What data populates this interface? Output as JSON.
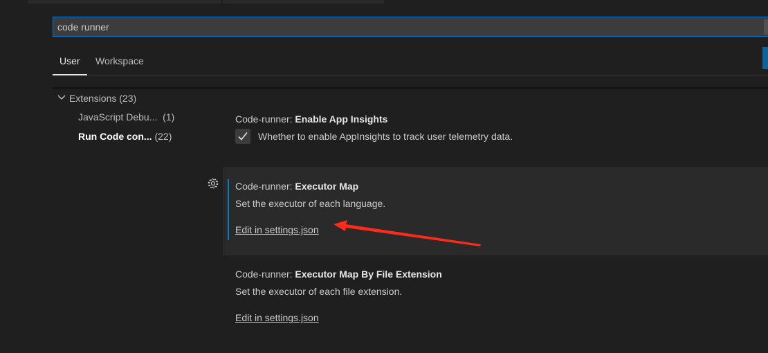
{
  "search": {
    "value": "code runner"
  },
  "tabs": [
    {
      "label": "User",
      "active": true
    },
    {
      "label": "Workspace",
      "active": false
    }
  ],
  "tree": {
    "group": {
      "label": "Extensions",
      "count": "(23)"
    },
    "items": [
      {
        "label": "JavaScript Debu...",
        "count": "(1)",
        "bold": false
      },
      {
        "label": "Run Code con...",
        "count": "(22)",
        "bold": true
      }
    ]
  },
  "settings": [
    {
      "prefix": "Code-runner: ",
      "name": "Enable App Insights",
      "description": "Whether to enable AppInsights to track user telemetry data.",
      "checked": true
    },
    {
      "prefix": "Code-runner: ",
      "name": "Executor Map",
      "description": "Set the executor of each language.",
      "link": "Edit in settings.json"
    },
    {
      "prefix": "Code-runner: ",
      "name": "Executor Map By File Extension",
      "description": "Set the executor of each file extension.",
      "link": "Edit in settings.json"
    }
  ],
  "colors": {
    "accent": "#0078d4",
    "annotation_arrow": "#ff2a1a"
  },
  "icons": {
    "gear": "gear-icon",
    "chevron": "chevron-down-icon",
    "check": "check-icon"
  }
}
